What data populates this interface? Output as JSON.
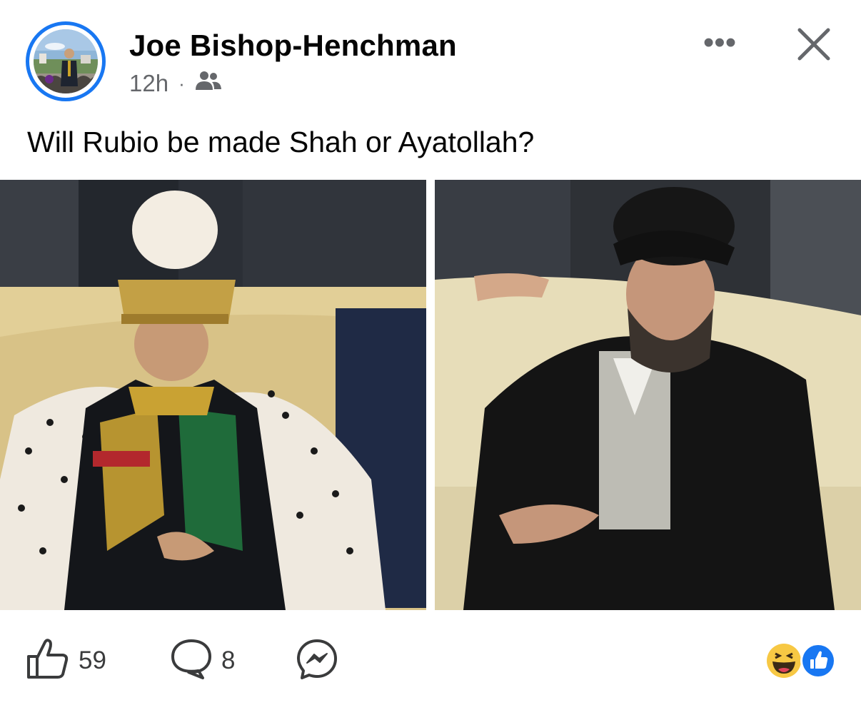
{
  "post": {
    "author": "Joe Bishop-Henchman",
    "time": "12h",
    "separator": "·",
    "audience_icon": "friends-icon",
    "text": "Will Rubio be made Shah or Ayatollah?"
  },
  "header_actions": {
    "more_icon": "more-options-icon",
    "more_label": "•••",
    "close_icon": "close-icon"
  },
  "images": [
    {
      "name": "photo-left",
      "label": "man in crown and ermine cape seated on couch"
    },
    {
      "name": "photo-right",
      "label": "man in black turban and robe seated on couch"
    }
  ],
  "footer": {
    "like_count": "59",
    "comment_count": "8",
    "like_icon": "thumbs-up-icon",
    "comment_icon": "comment-icon",
    "share_icon": "messenger-icon",
    "reaction_icons": [
      "haha-reaction-icon",
      "like-reaction-icon"
    ]
  },
  "colors": {
    "accent": "#1877f2",
    "secondary_text": "#65676b"
  }
}
